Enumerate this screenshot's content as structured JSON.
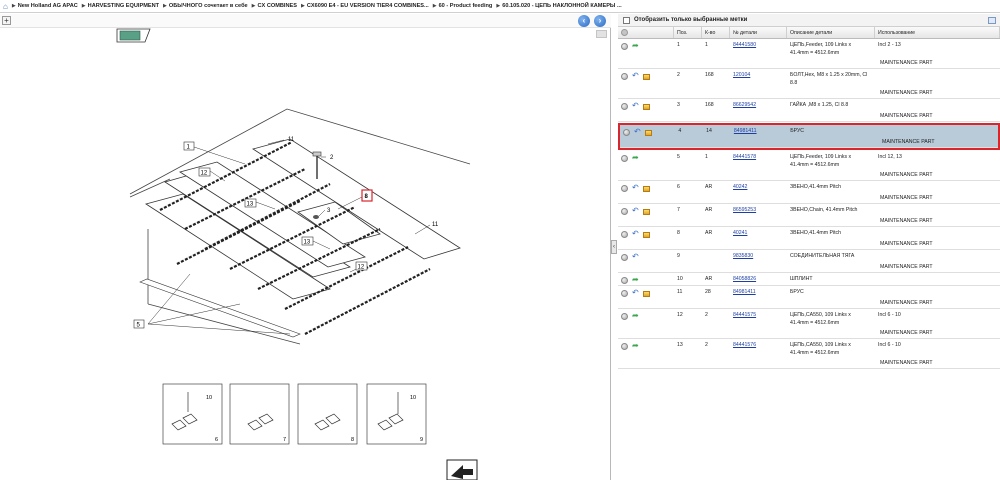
{
  "breadcrumb": {
    "items": [
      "New Holland AG APAC",
      "HARVESTING EQUIPMENT",
      "ОБЫЧНОГО сочетает в себе",
      "CX COMBINES",
      "CX6090 E4 - EU VERSION TIER4 COMBINES...",
      "60 - Product feeding",
      "60.105.020 - ЦЕПЬ НАКЛОННОЙ КАМЕРЫ ..."
    ]
  },
  "diagram": {
    "callouts": [
      "1",
      "2",
      "3",
      "5",
      "8",
      "11",
      "11",
      "12",
      "12",
      "12",
      "13",
      "13"
    ],
    "thumbs": [
      {
        "id": "6",
        "ref": "10"
      },
      {
        "id": "7",
        "ref": ""
      },
      {
        "id": "8",
        "ref": ""
      },
      {
        "id": "9",
        "ref": "10"
      }
    ]
  },
  "parts": {
    "filter_label": "Отобразить только выбранные метки",
    "columns": {
      "pos": "Поз.",
      "qty": "К-во",
      "part_no": "№ детали",
      "desc": "Описание детали",
      "usage": "Использование"
    },
    "maintenance_label": "MAINTENANCE PART",
    "rows": [
      {
        "pos": "1",
        "qty": "1",
        "part_no": "84441580",
        "desc_1": "ЦЕПЬ,Feeder, 109 Links x",
        "desc_2": "41.4mm = 4512.6mm",
        "usage": "Incl 2 - 13",
        "icon": "green",
        "box": false,
        "selected": false
      },
      {
        "pos": "2",
        "qty": "168",
        "part_no": "120104",
        "desc_1": "БОЛТ,Hex, M8 x 1.25 x 20mm, Cl",
        "desc_2": "8.8",
        "usage": "",
        "icon": "blue",
        "box": true,
        "selected": false
      },
      {
        "pos": "3",
        "qty": "168",
        "part_no": "86629542",
        "desc_1": "ГАЙКА ,M8 x 1.25, Cl 8.8",
        "desc_2": "",
        "usage": "",
        "icon": "blue",
        "box": true,
        "selected": false
      },
      {
        "pos": "4",
        "qty": "14",
        "part_no": "84981411",
        "desc_1": "БРУС",
        "desc_2": "",
        "usage": "",
        "icon": "blue",
        "box": true,
        "selected": true
      },
      {
        "pos": "5",
        "qty": "1",
        "part_no": "84441578",
        "desc_1": "ЦЕПЬ,Feeder, 109 Links x",
        "desc_2": "41.4mm = 4512.6mm",
        "usage": "Incl 12, 13",
        "icon": "green",
        "box": false,
        "selected": false
      },
      {
        "pos": "6",
        "qty": "AR",
        "part_no": "40242",
        "desc_1": "ЗВЕНО,41.4mm Pitch",
        "desc_2": "",
        "usage": "",
        "icon": "blue",
        "box": true,
        "selected": false
      },
      {
        "pos": "7",
        "qty": "AR",
        "part_no": "86595253",
        "desc_1": "ЗВЕНО,Chain, 41.4mm Pitch",
        "desc_2": "",
        "usage": "",
        "icon": "blue",
        "box": true,
        "selected": false
      },
      {
        "pos": "8",
        "qty": "AR",
        "part_no": "40241",
        "desc_1": "ЗВЕНО,41.4mm Pitch",
        "desc_2": "",
        "usage": "",
        "icon": "blue",
        "box": true,
        "selected": false
      },
      {
        "pos": "9",
        "qty": "",
        "part_no": "9835830",
        "desc_1": "СОЕДИНИТЕЛЬНАЯ ТЯГА",
        "desc_2": "",
        "usage": "",
        "icon": "blue",
        "box": false,
        "selected": false
      },
      {
        "pos": "10",
        "qty": "AR",
        "part_no": "84058826",
        "desc_1": "ШПЛИНТ",
        "desc_2": "",
        "usage": "",
        "icon": "green",
        "box": false,
        "selected": false,
        "no_maint": true
      },
      {
        "pos": "11",
        "qty": "28",
        "part_no": "84981411",
        "desc_1": "БРУС",
        "desc_2": "",
        "usage": "",
        "icon": "blue",
        "box": true,
        "selected": false
      },
      {
        "pos": "12",
        "qty": "2",
        "part_no": "84441575",
        "desc_1": "ЦЕПЬ,CA550, 109 Links x",
        "desc_2": "41.4mm = 4512.6mm",
        "usage": "Incl 6 - 10",
        "icon": "green",
        "box": false,
        "selected": false
      },
      {
        "pos": "13",
        "qty": "2",
        "part_no": "84441576",
        "desc_1": "ЦЕПЬ,CA550, 109 Links x",
        "desc_2": "41.4mm = 4512.6mm",
        "usage": "Incl 6 - 10",
        "icon": "green",
        "box": false,
        "selected": false
      }
    ]
  }
}
